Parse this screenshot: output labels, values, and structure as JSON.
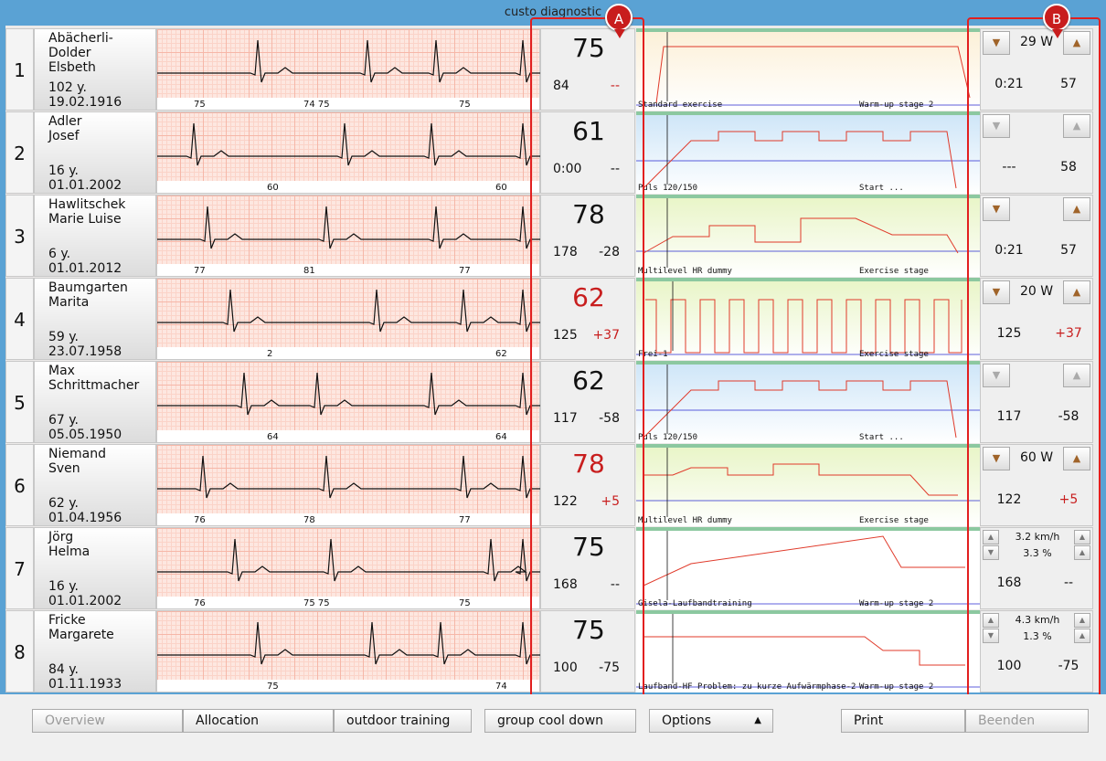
{
  "window": {
    "title": "custo diagnostic"
  },
  "callouts": {
    "a": "A",
    "b": "B"
  },
  "rows": [
    {
      "num": "1",
      "name1": "Abächerli-Dolder",
      "name2": "Elsbeth",
      "age": "102 y.",
      "dob": "19.02.1916",
      "ticks": [
        "75",
        "74 75",
        "75"
      ],
      "hr": "75",
      "hr_red": false,
      "v_a": "84",
      "v_b": "--",
      "v_b_red": true,
      "profile_left": "Standard exercise",
      "profile_right": "Warm-up stage 2",
      "profile_bg": "warm",
      "ctrl": {
        "mode": "watt",
        "power": "29 W",
        "btn_enabled": true,
        "v1": "0:21",
        "v2": "57",
        "v2_red": false
      }
    },
    {
      "num": "2",
      "name1": "Adler",
      "name2": "Josef",
      "age": "16 y.",
      "dob": "01.01.2002",
      "ticks": [
        "60",
        "60"
      ],
      "hr": "61",
      "hr_red": false,
      "v_a": "0:00",
      "v_b": "--",
      "v_b_red": false,
      "profile_left": "Puls 120/150",
      "profile_right": "Start ...",
      "profile_bg": "blue",
      "ctrl": {
        "mode": "watt",
        "power": "",
        "btn_enabled": false,
        "v1": "---",
        "v2": "58",
        "v2_red": false
      }
    },
    {
      "num": "3",
      "name1": "Hawlitschek",
      "name2": "Marie Luise",
      "age": "6 y.",
      "dob": "01.01.2012",
      "ticks": [
        "77",
        "81",
        "77"
      ],
      "hr": "78",
      "hr_red": false,
      "v_a": "178",
      "v_b": "-28",
      "v_b_red": false,
      "profile_left": "Multilevel HR dummy",
      "profile_right": "Exercise stage",
      "profile_bg": "green",
      "ctrl": {
        "mode": "watt",
        "power": "",
        "btn_enabled": true,
        "v1": "0:21",
        "v2": "57",
        "v2_red": false
      }
    },
    {
      "num": "4",
      "name1": "Baumgarten",
      "name2": "Marita",
      "age": "59 y.",
      "dob": "23.07.1958",
      "ticks": [
        "2",
        "62"
      ],
      "hr": "62",
      "hr_red": true,
      "v_a": "125",
      "v_b": "+37",
      "v_b_red": true,
      "profile_left": "Frei-1",
      "profile_right": "Exercise stage",
      "profile_bg": "green",
      "ctrl": {
        "mode": "watt",
        "power": "20 W",
        "btn_enabled": true,
        "v1": "125",
        "v2": "+37",
        "v2_red": true
      }
    },
    {
      "num": "5",
      "name1": "Max",
      "name2": "Schrittmacher",
      "age": "67 y.",
      "dob": "05.05.1950",
      "ticks": [
        "64",
        "64"
      ],
      "hr": "62",
      "hr_red": false,
      "v_a": "117",
      "v_b": "-58",
      "v_b_red": false,
      "profile_left": "Puls 120/150",
      "profile_right": "Start ...",
      "profile_bg": "blue",
      "ctrl": {
        "mode": "watt",
        "power": "",
        "btn_enabled": false,
        "v1": "117",
        "v2": "-58",
        "v2_red": false
      }
    },
    {
      "num": "6",
      "name1": "Niemand",
      "name2": "Sven",
      "age": "62 y.",
      "dob": "01.04.1956",
      "ticks": [
        "76",
        "78",
        "77"
      ],
      "hr": "78",
      "hr_red": true,
      "v_a": "122",
      "v_b": "+5",
      "v_b_red": true,
      "profile_left": "Multilevel HR dummy",
      "profile_right": "Exercise stage",
      "profile_bg": "green",
      "ctrl": {
        "mode": "watt",
        "power": "60 W",
        "btn_enabled": true,
        "v1": "122",
        "v2": "+5",
        "v2_red": true
      }
    },
    {
      "num": "7",
      "name1": "Jörg",
      "name2": "Helma",
      "age": "16 y.",
      "dob": "01.01.2002",
      "ticks": [
        "76",
        "75 75",
        "75"
      ],
      "hr": "75",
      "hr_red": false,
      "v_a": "168",
      "v_b": "--",
      "v_b_red": false,
      "profile_left": "Gisela-Laufbandtraining",
      "profile_right": "Warm-up stage 2",
      "profile_bg": "white",
      "ctrl": {
        "mode": "treadmill",
        "speed": "3.2 km/h",
        "incline": "3.3 %",
        "v1": "168",
        "v2": "--",
        "v2_red": false
      }
    },
    {
      "num": "8",
      "name1": "Fricke",
      "name2": "Margarete",
      "age": "84 y.",
      "dob": "01.11.1933",
      "ticks": [
        "75",
        "74"
      ],
      "hr": "75",
      "hr_red": false,
      "v_a": "100",
      "v_b": "-75",
      "v_b_red": false,
      "profile_left": "Laufband-HF Problem: zu kurze Aufwärmphase-2",
      "profile_right": "Warm-up stage 2",
      "profile_bg": "white",
      "ctrl": {
        "mode": "treadmill",
        "speed": "4.3 km/h",
        "incline": "1.3 %",
        "v1": "100",
        "v2": "-75",
        "v2_red": false
      }
    }
  ],
  "toolbar": {
    "overview": "Overview",
    "allocation": "Allocation",
    "outdoor": "outdoor training",
    "cooldown": "group cool down",
    "options": "Options",
    "print": "Print",
    "beenden": "Beenden"
  },
  "colors": {
    "alert_red": "#c81e1e",
    "profile_line": "#e03a2a",
    "hr_line": "#1b72b8",
    "callout": "#e21f1f"
  },
  "icons": {
    "arrow_up": "triangle-up-icon",
    "arrow_down": "triangle-down-icon"
  }
}
